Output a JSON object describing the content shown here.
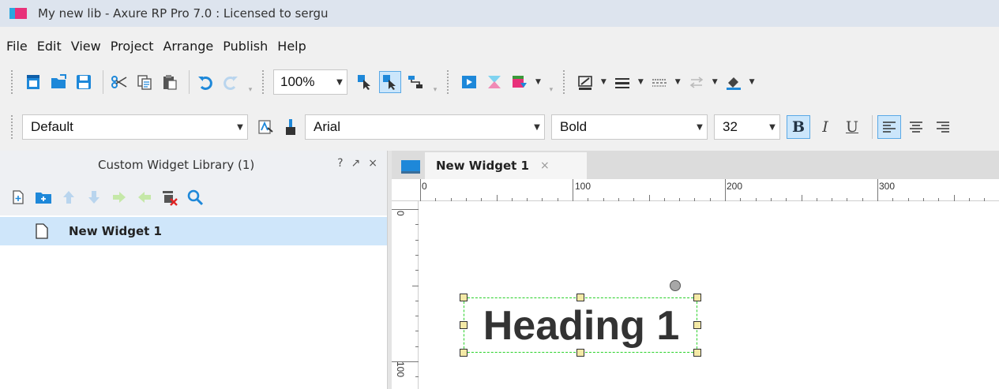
{
  "window": {
    "title": "My new lib - Axure RP Pro 7.0 : Licensed to sergu"
  },
  "menu": {
    "items": [
      "File",
      "Edit",
      "View",
      "Project",
      "Arrange",
      "Publish",
      "Help"
    ]
  },
  "toolbar": {
    "zoom_value": "100%",
    "icons": [
      "new-page-icon",
      "open-folder-icon",
      "save-icon",
      "cut-icon",
      "copy-icon",
      "paste-icon",
      "undo-icon",
      "redo-icon",
      "select-intersected-icon",
      "select-contained-icon",
      "connector-icon",
      "preview-icon",
      "share-icon",
      "publish-icon",
      "fill-icon",
      "line-weight-icon",
      "line-style-icon",
      "arrow-style-icon",
      "fill-color-icon"
    ]
  },
  "format_bar": {
    "style_value": "Default",
    "font_value": "Arial",
    "weight_value": "Bold",
    "size_value": "32",
    "bold_label": "B",
    "italic_label": "I",
    "underline_label": "U"
  },
  "library_panel": {
    "title": "Custom Widget Library (1)",
    "controls": [
      "?",
      "↗",
      "×"
    ],
    "items": [
      {
        "label": "New Widget 1",
        "selected": true
      }
    ]
  },
  "editor": {
    "tab_label": "New Widget 1",
    "tab_close": "×",
    "h_ruler_labels": [
      "0",
      "100",
      "200",
      "300"
    ],
    "v_ruler_labels": [
      "0",
      "100"
    ],
    "widget_text": "Heading 1"
  },
  "colors": {
    "accent": "#2aa7df",
    "brand_pink": "#e8317a",
    "selection_blue": "#cfe6fa",
    "selection_dashed": "#29d129"
  }
}
